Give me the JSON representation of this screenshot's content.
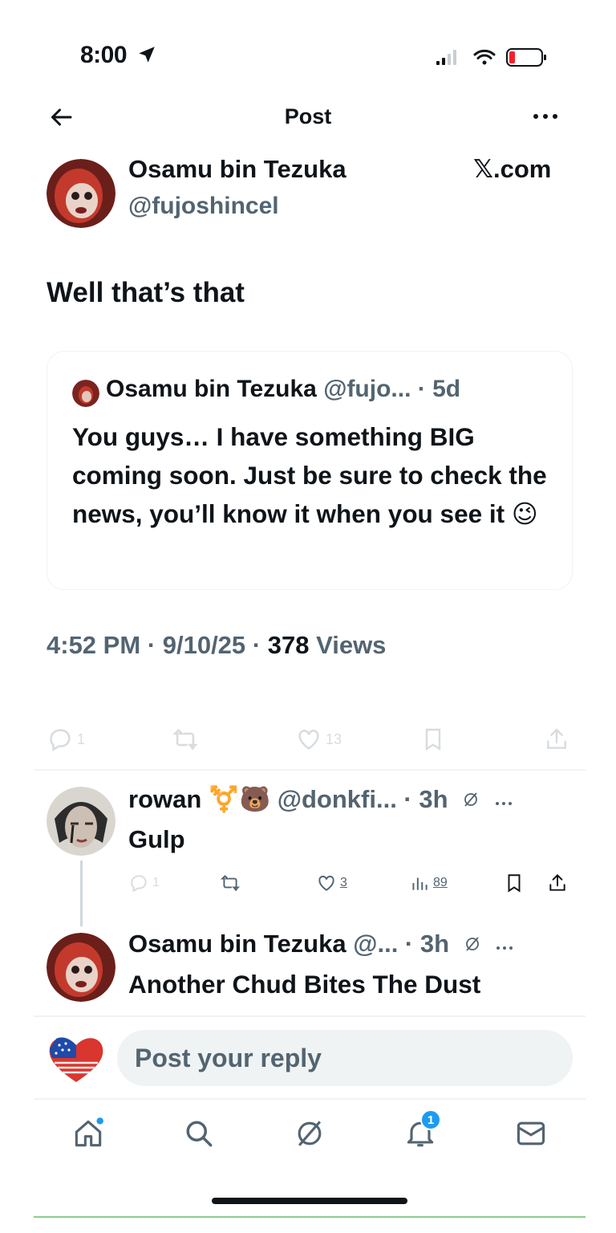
{
  "status_bar": {
    "time": "8:00",
    "icons": [
      "location-arrow-icon",
      "signal-icon",
      "wifi-icon",
      "battery-low-icon"
    ]
  },
  "header": {
    "title": "Post",
    "back_icon": "back-arrow-icon",
    "more_icon": "more-dots-icon"
  },
  "post": {
    "author_name": "Osamu bin Tezuka",
    "author_handle": "@fujoshincel",
    "site_label": "𝕏.com",
    "text": "Well that’s that",
    "quote": {
      "author_name": "Osamu bin Tezuka",
      "author_handle": "@fujo...",
      "age": "5d",
      "text": "You guys… I have something BIG coming soon. Just be sure to check the news, you’ll know it when you see it 😉"
    },
    "timestamp": "4:52 PM",
    "date": "9/10/25",
    "views_count": "378",
    "views_label": "Views",
    "actions": {
      "replies": "1",
      "likes": "13"
    }
  },
  "replies": [
    {
      "author_name": "rowan",
      "badges": "⚧️🐻",
      "author_handle": "@donkfi...",
      "age": "3h",
      "text": "Gulp",
      "reply_count": "1",
      "like_count": "3",
      "view_count": "89"
    },
    {
      "author_name": "Osamu bin Tezuka",
      "author_handle": "@...",
      "age": "3h",
      "text": "Another Chud Bites The Dust"
    }
  ],
  "composer": {
    "placeholder": "Post your reply"
  },
  "tab_bar": {
    "notification_count": "1",
    "tabs": [
      "home-icon",
      "search-icon",
      "grok-icon",
      "notifications-icon",
      "messages-icon"
    ]
  },
  "colors": {
    "text": "#0f1419",
    "secondary": "#536471",
    "accent": "#1d9bf0",
    "divider": "#eff3f4",
    "battery_red": "#f4212e"
  }
}
